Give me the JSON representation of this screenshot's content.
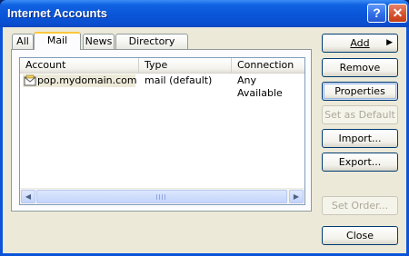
{
  "window": {
    "title": "Internet Accounts"
  },
  "titlebar": {
    "help_glyph": "?",
    "close_glyph": "✕"
  },
  "tabs": [
    {
      "label": "All",
      "active": false
    },
    {
      "label": "Mail",
      "active": true
    },
    {
      "label": "News",
      "active": false
    },
    {
      "label": "Directory Service",
      "active": false
    }
  ],
  "list": {
    "columns": [
      "Account",
      "Type",
      "Connection"
    ],
    "rows": [
      {
        "account": "pop.mydomain.com",
        "type": "mail (default)",
        "connection": "Any Available",
        "icon": "mail-account-icon",
        "selected": true
      }
    ]
  },
  "buttons": {
    "add": "Add",
    "remove": "Remove",
    "properties": "Properties",
    "set_default": "Set as Default",
    "import": "Import...",
    "export": "Export...",
    "set_order": "Set Order...",
    "close": "Close"
  },
  "colors": {
    "titlebar": "#0a55d8",
    "dialog": "#ece9d8",
    "tab_highlight": "#ffc73c",
    "close_button": "#d5502b"
  }
}
